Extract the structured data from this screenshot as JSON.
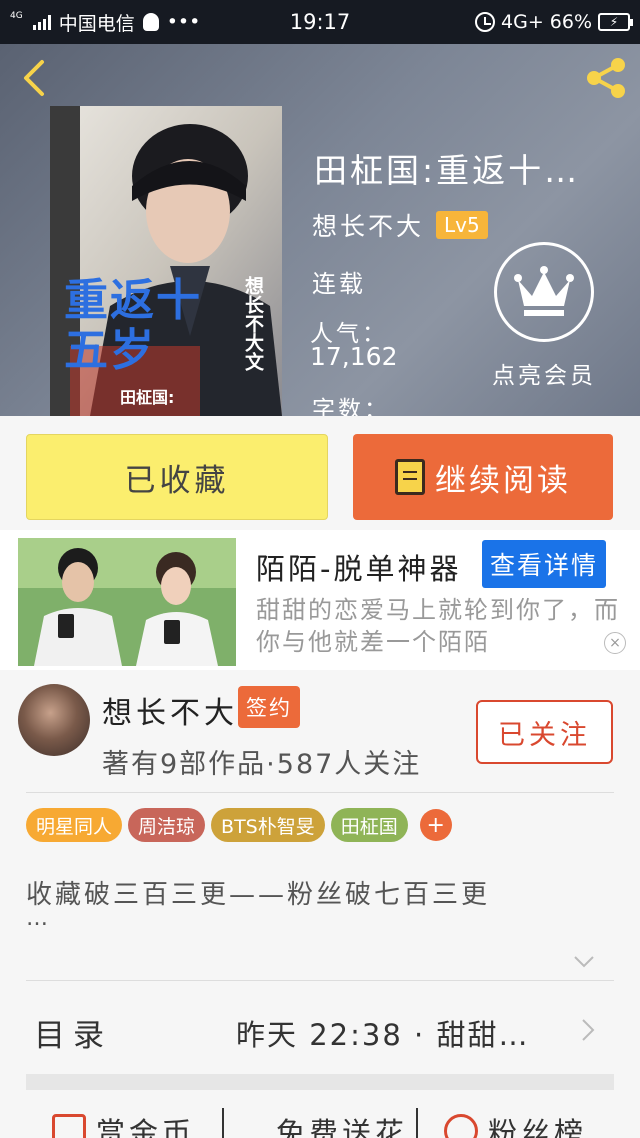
{
  "status_bar": {
    "network_tag": "4G",
    "carrier": "中国电信",
    "more": "•••",
    "time": "19:17",
    "network": "4G+",
    "battery": "66%"
  },
  "header": {
    "book_title": "田柾国:重返十…",
    "author": "想长不大",
    "level": "Lv5",
    "serial_status": "连载",
    "popularity_label": "人气：",
    "popularity_value": "17,162",
    "word_count_label": "字数：",
    "vip_label": "点亮会员",
    "cover_text": {
      "main": "重返十五岁",
      "author_vertical": "想长不大文",
      "sub": "田柾国:"
    }
  },
  "actions": {
    "collected": "已收藏",
    "continue_reading": "继续阅读"
  },
  "ad": {
    "title": "陌陌-脱单神器",
    "detail_button": "查看详情",
    "description": "甜甜的恋爱马上就轮到你了，而你与他就差一个陌陌"
  },
  "author_section": {
    "name": "想长不大",
    "signed_badge": "签约",
    "meta": "著有9部作品·587人关注",
    "follow_button": "已关注"
  },
  "tags": [
    {
      "label": "明星同人",
      "color": "#f7a933"
    },
    {
      "label": "周洁琼",
      "color": "#c8665a"
    },
    {
      "label": "BTS朴智旻",
      "color": "#cda23a"
    },
    {
      "label": "田柾国",
      "color": "#8fb457"
    }
  ],
  "tag_more": "+",
  "description": {
    "text": "收藏破三百三更——粉丝破七百三更",
    "more": "…"
  },
  "catalog": {
    "label": "目录",
    "latest": "昨天 22:38 · 甜甜…"
  },
  "bottom": {
    "reward": "赏金币",
    "flowers": "免费送花",
    "fans": "粉丝榜"
  },
  "colors": {
    "accent_orange": "#ec6a3a",
    "collected_yellow": "#fbee6e",
    "ad_blue": "#1a73e8",
    "follow_red": "#d9482f"
  }
}
